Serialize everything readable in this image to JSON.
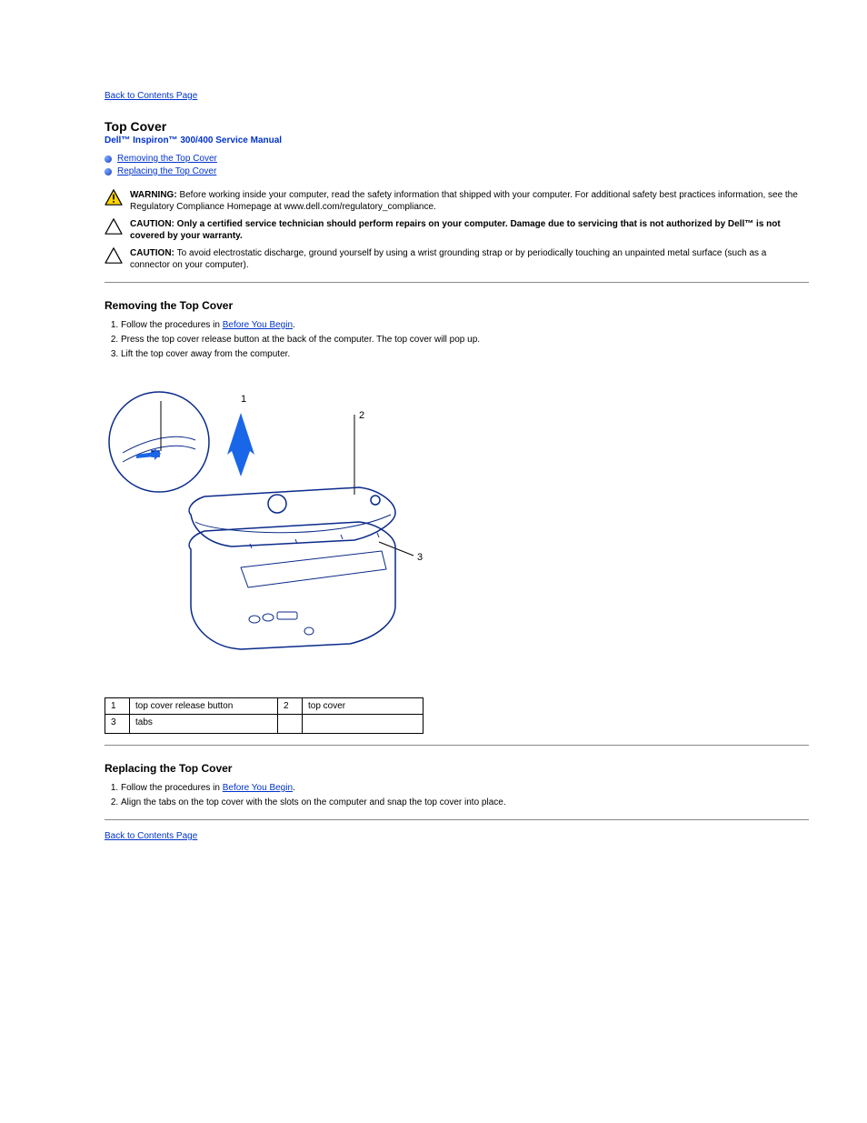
{
  "nav": {
    "back": "Back to Contents Page"
  },
  "header": {
    "title": "Top Cover",
    "subtitle": "Dell™ Inspiron™ 300/400 Service Manual"
  },
  "toc": {
    "remove": "Removing the Top Cover",
    "replace": "Replacing the Top Cover"
  },
  "warn": {
    "label": "WARNING: ",
    "text": "Before working inside your computer, read the safety information that shipped with your computer. For additional safety best practices information, see the Regulatory Compliance Homepage at www.dell.com/regulatory_compliance."
  },
  "caution1": {
    "label": "CAUTION: ",
    "text_bold": "Only a certified service technician should perform repairs on your computer. Damage due to servicing that is not authorized by Dell™ is not covered by your warranty."
  },
  "caution2": {
    "label": "CAUTION: ",
    "text": "To avoid electrostatic discharge, ground yourself by using a wrist grounding strap or by periodically touching an unpainted metal surface (such as a connector on your computer)."
  },
  "remove": {
    "heading": "Removing the Top Cover",
    "steps": {
      "s1a": "Follow the procedures in ",
      "s1link": "Before You Begin",
      "s1b": ".",
      "s2": "Press the top cover release button at the back of the computer. The top cover will pop up.",
      "s3": "Lift the top cover away from the computer."
    }
  },
  "legend": {
    "r1c1": "1",
    "r1c2": "top cover release button",
    "r1c3": "2",
    "r1c4": "top cover",
    "r2c1": "3",
    "r2c2": "tabs"
  },
  "replace": {
    "heading": "Replacing the Top Cover",
    "steps": {
      "s1a": "Follow the procedures in ",
      "s1link": "Before You Begin",
      "s1b": ".",
      "s2": "Align the tabs on the top cover with the slots on the computer and snap the top cover into place."
    }
  },
  "footer": {
    "back": "Back to Contents Page"
  }
}
